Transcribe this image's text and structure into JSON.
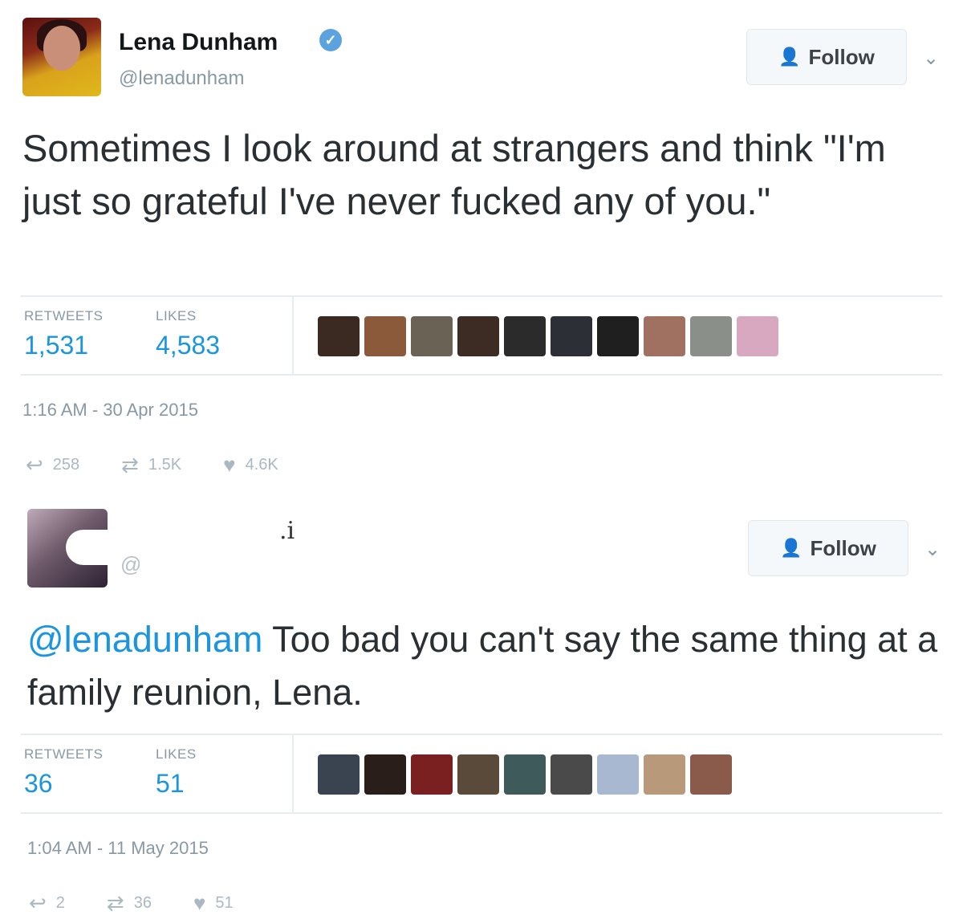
{
  "tweets": [
    {
      "name": "Lena Dunham",
      "verified": true,
      "handle": "@lenadunham",
      "follow_label": "Follow",
      "text": "Sometimes I look around at strangers and think \"I'm just so grateful I've never fucked any of you.\"",
      "retweets_label": "RETWEETS",
      "retweets": "1,531",
      "likes_label": "LIKES",
      "likes": "4,583",
      "timestamp": "1:16 AM - 30 Apr 2015",
      "reply_count": "258",
      "retweet_count": "1.5K",
      "like_count": "4.6K",
      "liker_colors": [
        "#3a2a22",
        "#8a5a3a",
        "#6b6256",
        "#3d2c24",
        "#2b2b2b",
        "#2c3036",
        "#1f1f1f",
        "#a07060",
        "#8a8f8a",
        "#d8a8c0"
      ]
    },
    {
      "name": ".i",
      "handle": "@",
      "follow_label": "Follow",
      "mention": "@lenadunham",
      "text": " Too bad you can't say the same thing at a family reunion, Lena.",
      "retweets_label": "RETWEETS",
      "retweets": "36",
      "likes_label": "LIKES",
      "likes": "51",
      "timestamp": "1:04 AM - 11 May 2015",
      "reply_count": "2",
      "retweet_count": "36",
      "like_count": "51",
      "liker_colors": [
        "#3a4450",
        "#2a1e1a",
        "#7a2020",
        "#5a4a3a",
        "#3f5a5a",
        "#4a4a4a",
        "#a8b8d0",
        "#b89a7a",
        "#8a5a4a"
      ]
    }
  ],
  "icons": {
    "follow": "person-plus-icon",
    "caret": "chevron-down-icon",
    "verified": "verified-badge-icon",
    "reply": "reply-icon",
    "retweet": "retweet-icon",
    "like": "heart-icon"
  }
}
